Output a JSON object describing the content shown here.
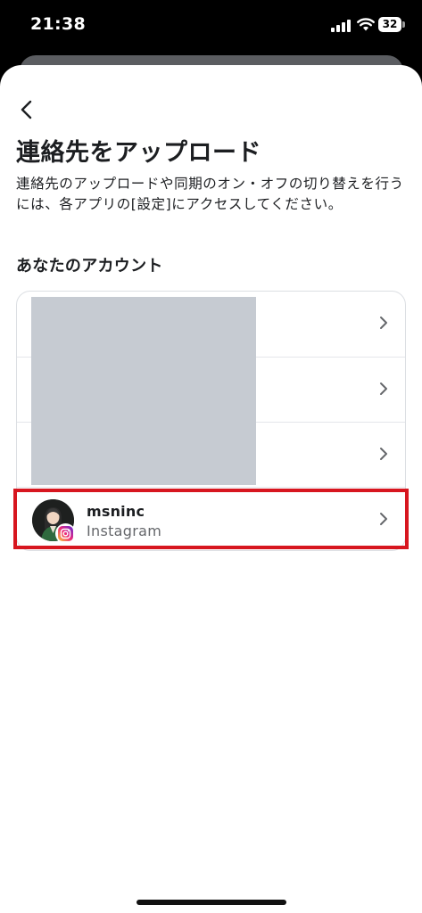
{
  "status_bar": {
    "time": "21:38",
    "battery_level": "32"
  },
  "header": {
    "title": "連絡先をアップロード",
    "description": "連絡先のアップロードや同期のオン・オフの切り替えを行うには、各アプリの[設定]にアクセスしてください。"
  },
  "accounts_section": {
    "heading": "あなたのアカウント",
    "accounts": [
      {
        "name": "",
        "platform": ""
      },
      {
        "name": "",
        "platform": ""
      },
      {
        "name": "",
        "platform": ""
      },
      {
        "name": "msninc",
        "platform": "Instagram"
      }
    ]
  },
  "colors": {
    "highlight": "#d7161f",
    "redacted": "#c6cbd2",
    "secondary_text": "#65676b"
  },
  "icons": [
    "back-arrow-icon",
    "chevron-right-icon",
    "instagram-icon",
    "signal-icon",
    "wifi-icon",
    "battery-icon"
  ]
}
